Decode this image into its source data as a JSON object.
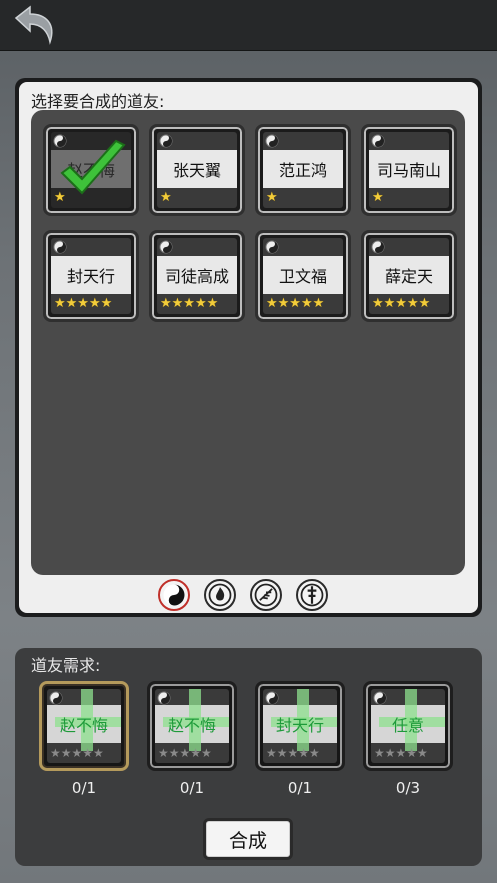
{
  "header": {
    "back_icon": "back-arrow-icon"
  },
  "selection": {
    "title": "选择要合成的道友:",
    "cards": [
      {
        "name": "赵不悔",
        "stars": 1,
        "selected": true
      },
      {
        "name": "张天翼",
        "stars": 1,
        "selected": false
      },
      {
        "name": "范正鸿",
        "stars": 1,
        "selected": false
      },
      {
        "name": "司马南山",
        "stars": 1,
        "selected": false
      },
      {
        "name": "封天行",
        "stars": 5,
        "selected": false
      },
      {
        "name": "司徒高成",
        "stars": 5,
        "selected": false
      },
      {
        "name": "卫文福",
        "stars": 5,
        "selected": false
      },
      {
        "name": "薛定天",
        "stars": 5,
        "selected": false
      }
    ],
    "tabs": [
      "yin-yang-icon",
      "fire-emblem-icon",
      "feather-emblem-icon",
      "sword-emblem-icon"
    ],
    "active_tab": 0
  },
  "requirements": {
    "title": "道友需求:",
    "items": [
      {
        "name": "赵不悔",
        "count": "0/1",
        "stars": 5
      },
      {
        "name": "赵不悔",
        "count": "0/1",
        "stars": 5
      },
      {
        "name": "封天行",
        "count": "0/1",
        "stars": 5
      },
      {
        "name": "任意",
        "count": "0/3",
        "stars": 5
      }
    ],
    "button_label": "合成"
  },
  "colors": {
    "accent_star": "#f2cc3a",
    "check": "#3ec23a",
    "required_name": "#1e9a3a",
    "active_tab_ring": "#c0302a"
  }
}
